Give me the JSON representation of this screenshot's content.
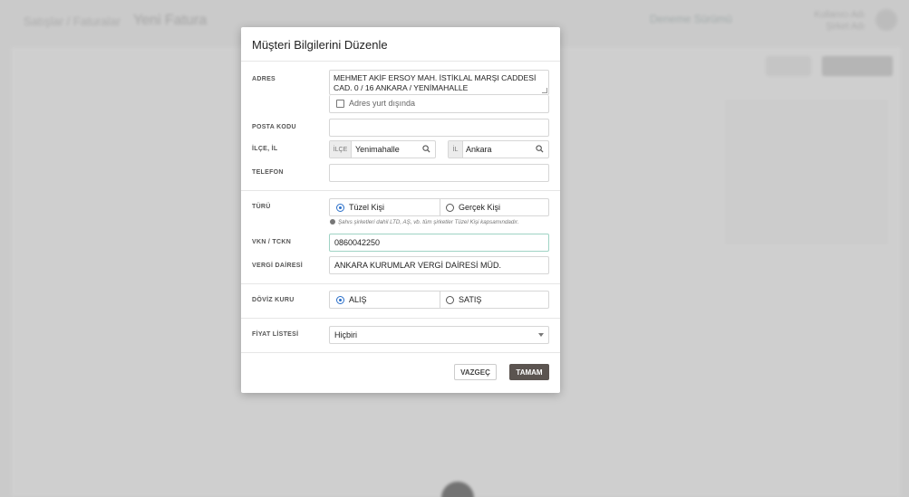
{
  "background": {
    "breadcrumb": "Satışlar / Faturalar",
    "page_title": "Yeni Fatura",
    "trial_text": "Deneme Sürümü",
    "user_name": "Kullanıcı Adı",
    "user_sub": "Şirket Adı"
  },
  "modal": {
    "title": "Müşteri Bilgilerini Düzenle",
    "address_label": "ADRES",
    "address_value": "MEHMET AKİF ERSOY MAH. İSTİKLAL MARŞI CADDESİ CAD. 0 / 16 ANKARA / YENİMAHALLE",
    "abroad_label": "Adres yurt dışında",
    "postal_label": "POSTA KODU",
    "postal_value": "",
    "district_city_label": "İLÇE, İL",
    "district_prefix": "İLÇE",
    "district_value": "Yenimahalle",
    "city_prefix": "İL",
    "city_value": "Ankara",
    "phone_label": "TELEFON",
    "phone_value": "",
    "type_label": "TÜRÜ",
    "type_options": [
      "Tüzel Kişi",
      "Gerçek Kişi"
    ],
    "type_selected": "Tüzel Kişi",
    "type_info": "Şahıs şirketleri dahil LTD, AŞ, vb. tüm şirketler Tüzel Kişi kapsamındadır.",
    "tax_id_label": "VKN / TCKN",
    "tax_id_value": "0860042250",
    "tax_office_label": "VERGİ DAİRESİ",
    "tax_office_value": "ANKARA KURUMLAR VERGİ DAİRESİ MÜD.",
    "currency_label": "DÖVİZ KURU",
    "currency_options": [
      "ALIŞ",
      "SATIŞ"
    ],
    "currency_selected": "ALIŞ",
    "price_list_label": "FİYAT LİSTESİ",
    "price_list_value": "Hiçbiri",
    "cancel_label": "VAZGEÇ",
    "ok_label": "TAMAM"
  },
  "icons": {
    "search": "search-icon",
    "info": "info-icon",
    "caret": "chevron-down-icon"
  },
  "colors": {
    "accent": "#2a6fc9",
    "primary_button": "#5b5450",
    "focus_border": "#9fd3c4"
  }
}
